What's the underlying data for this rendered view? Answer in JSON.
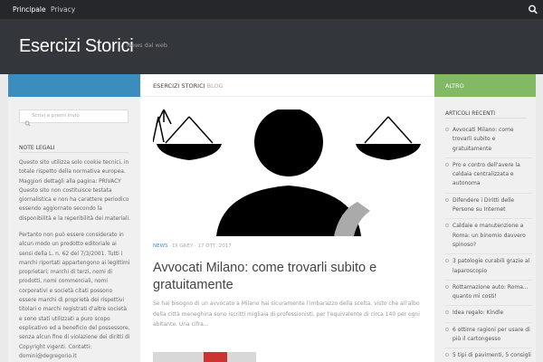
{
  "nav": {
    "items": [
      {
        "label": "Principale"
      },
      {
        "label": "Privacy"
      }
    ],
    "search_icon": "search-icon"
  },
  "header": {
    "title": "Esercizi Storici",
    "tagline": "News dal web"
  },
  "sidebar_left": {
    "search_placeholder": "Scrivi e premi invio",
    "note_title": "NOTE LEGALI",
    "note_p1": "Questo sito utilizza solo cookie tecnici, in totale rispetto della normativa europea. Maggiori dettagli alla pagina: PRIVACY Questo sito non costituisce testata giornalistica e non ha carattere periodico essendo aggiornato secondo la disponibilità e la reperibilità dei materiali.",
    "note_p2": "Pertanto non può essere considerato in alcun modo un prodotto editoriale ai sensi della L. n. 62 del 7/3/2001. Tutti i marchi riportati appartengono ai legittimi proprietari; marchi di terzi, nomi di prodotti, nomi commerciali, nomi corporativi e società citati possono essere marchi di proprietà dei rispettivi titolari o marchi registrati d'altre società e sono stati utilizzati a puro scopo esplicativo ed a beneficio del possessore, senza alcun fine di violazione dei diritti di Copyright vigenti. Contatti: domini@degregorio.it"
  },
  "main": {
    "head_site": "ESERCIZI STORICI",
    "head_section": "BLOG",
    "post": {
      "category": "NEWS",
      "author": "· DI GREY ·",
      "date": "17 OTT, 2017",
      "title": "Avvocati Milano: come trovarli subito e gratuitamente",
      "excerpt": "Se hai bisogno di un avvocato a Milano hai sicuramente l'imbarazzo della scelta, visto che all'albo della città meneghina sono iscritti migliaia di professionisti, per l'equivalente di circa 140 per ogni abitante. Una cifra..."
    }
  },
  "sidebar_right": {
    "bar_label": "ALTRO",
    "recent_title": "ARTICOLI RECENTI",
    "recent": [
      "Avvocati Milano: come trovarli subito e gratuitamente",
      "Pro e contro dell'avere la caldaia centralizzata e autonoma",
      "Difendere i Diritti delle Persone su Internet",
      "Caldaie e manutenzione a Roma: un binomio davvero spinoso?",
      "3 patologie curabili grazie al laparoscopio",
      "Rottamazione auto: Roma... quanto mi costi!",
      "Idea regalo: Kindle",
      "6 ottime ragioni per usare di più il cartongesso",
      "5 tipi di pavimenti, 5 consigli"
    ]
  },
  "colors": {
    "accent_blue": "#3b8dbd",
    "accent_green": "#82b965",
    "topbar": "#26272b",
    "header": "#33363b"
  }
}
